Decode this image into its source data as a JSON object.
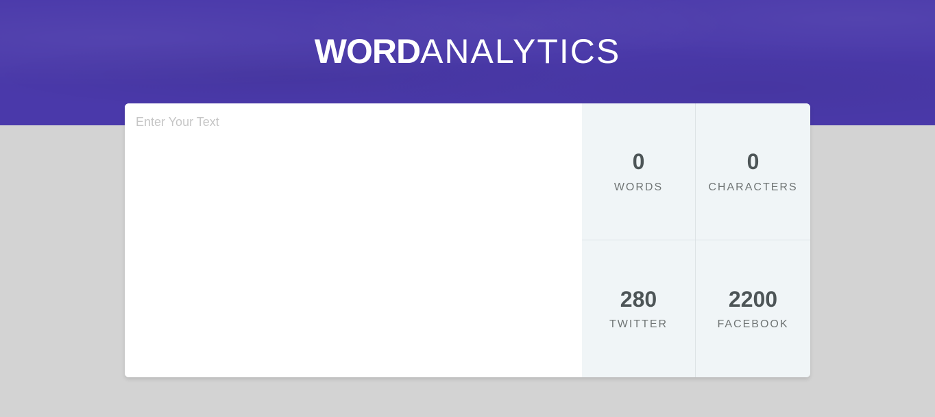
{
  "header": {
    "logo_bold": "WORD",
    "logo_light": "ANALYTICS",
    "background_color": "#4a39aa"
  },
  "editor": {
    "placeholder": "Enter Your Text",
    "value": ""
  },
  "stats": {
    "words": {
      "value": "0",
      "label": "WORDS"
    },
    "characters": {
      "value": "0",
      "label": "CHARACTERS"
    },
    "twitter": {
      "value": "280",
      "label": "TWITTER"
    },
    "facebook": {
      "value": "2200",
      "label": "FACEBOOK"
    }
  }
}
